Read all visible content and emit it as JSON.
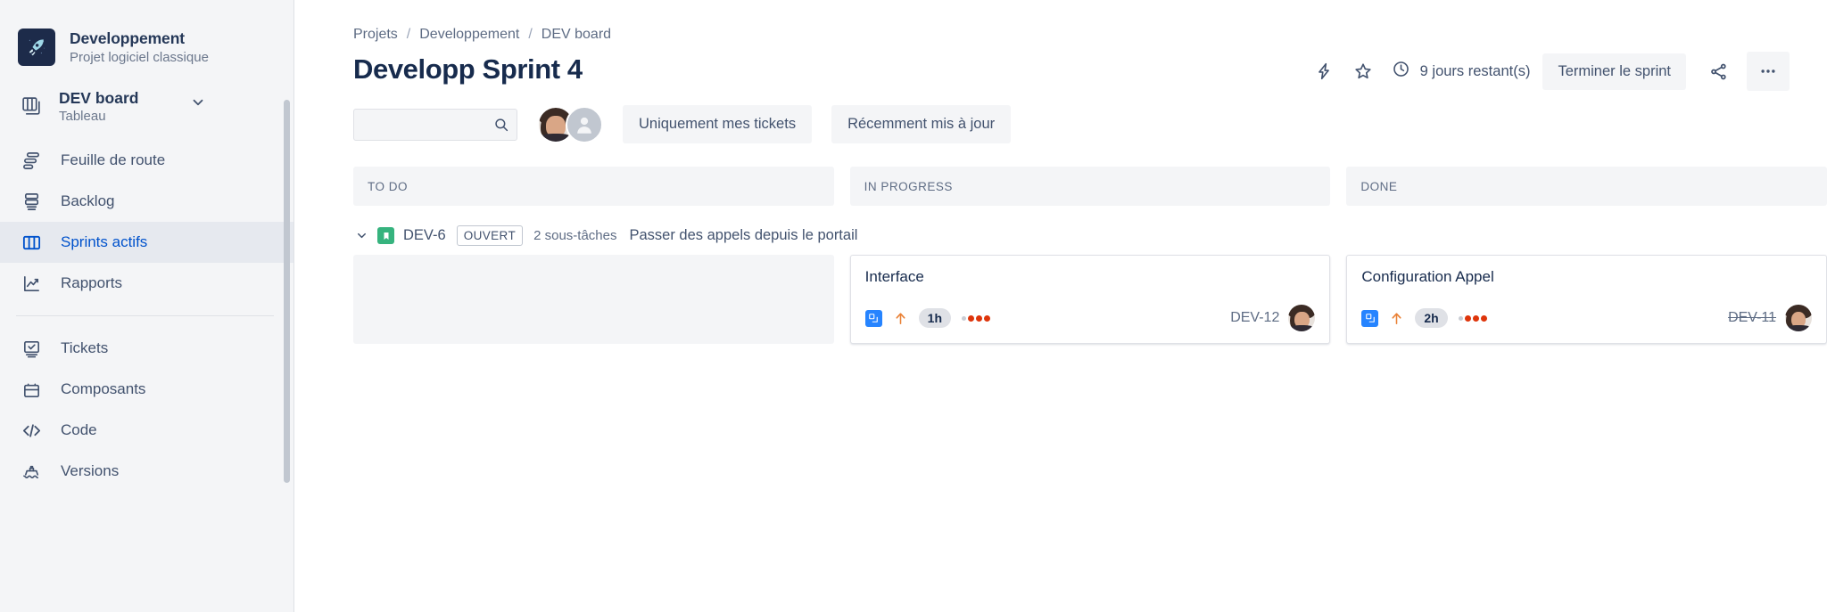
{
  "sidebar": {
    "project": {
      "name": "Developpement",
      "subtitle": "Projet logiciel classique",
      "icon": "rocket-icon"
    },
    "board": {
      "name": "DEV board",
      "subtitle": "Tableau",
      "chevron": "chevron-down-icon"
    },
    "items": [
      {
        "label": "Feuille de route",
        "icon": "roadmap-icon",
        "active": false
      },
      {
        "label": "Backlog",
        "icon": "backlog-icon",
        "active": false
      },
      {
        "label": "Sprints actifs",
        "icon": "board-columns-icon",
        "active": true
      },
      {
        "label": "Rapports",
        "icon": "reports-chart-icon",
        "active": false
      },
      {
        "label": "Tickets",
        "icon": "issues-icon",
        "active": false
      },
      {
        "label": "Composants",
        "icon": "components-icon",
        "active": false
      },
      {
        "label": "Code",
        "icon": "code-icon",
        "active": false
      },
      {
        "label": "Versions",
        "icon": "releases-ship-icon",
        "active": false
      }
    ]
  },
  "header": {
    "breadcrumbs": [
      "Projets",
      "Developpement",
      "DEV board"
    ],
    "separator": "/",
    "title": "Developp Sprint 4",
    "days_left": "9 jours restant(s)",
    "end_sprint_label": "Terminer le sprint",
    "icons": {
      "lightning": "lightning-bolt-icon",
      "star": "star-icon",
      "clock": "clock-icon",
      "share": "share-icon",
      "more": "more-options-icon"
    }
  },
  "filters": {
    "search_value": "",
    "search_placeholder": "",
    "search_icon": "search-icon",
    "avatars": [
      {
        "name": "user-avatar-photo",
        "type": "photo"
      },
      {
        "name": "user-avatar-placeholder",
        "type": "placeholder"
      }
    ],
    "buttons": [
      {
        "label": "Uniquement mes tickets"
      },
      {
        "label": "Récemment mis à jour"
      }
    ]
  },
  "board": {
    "columns": [
      {
        "title": "TO DO"
      },
      {
        "title": "IN PROGRESS"
      },
      {
        "title": "DONE"
      }
    ],
    "epic": {
      "chevron": "chevron-down-icon",
      "type_icon": "story-icon",
      "key": "DEV-6",
      "status_badge": "OUVERT",
      "subtask_count": "2 sous-tâches",
      "title": "Passer des appels depuis le portail"
    },
    "cards": {
      "todo": [],
      "in_progress": [
        {
          "title": "Interface",
          "type_icon": "subtask-icon",
          "priority_icon": "priority-high-arrow-icon",
          "estimate": "1h",
          "dots": 3,
          "key": "DEV-12",
          "done": false,
          "avatar": "assignee-avatar"
        }
      ],
      "done": [
        {
          "title": "Configuration Appel",
          "type_icon": "subtask-icon",
          "priority_icon": "priority-high-arrow-icon",
          "estimate": "2h",
          "dots": 3,
          "key": "DEV-11",
          "done": true,
          "avatar": "assignee-avatar"
        }
      ]
    }
  },
  "colors": {
    "accent": "#0052cc",
    "story_green": "#36b37e",
    "subtask_blue": "#2684ff",
    "priority_orange": "#e97f33",
    "dot_red": "#de350b",
    "sidebar_bg": "#f4f5f7",
    "text_dark": "#172b4d",
    "text_muted": "#5e6c84"
  }
}
